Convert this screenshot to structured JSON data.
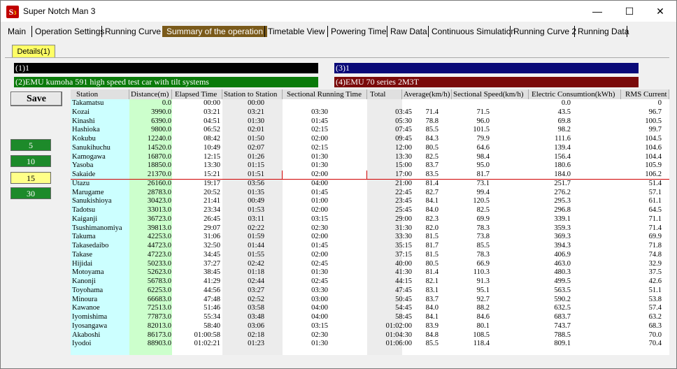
{
  "window": {
    "title": "Super Notch Man 3",
    "icon_letter": "S",
    "icon_sub": "3"
  },
  "controls": {
    "minimize": "—",
    "maximize": "☐",
    "close": "✕"
  },
  "tabs": [
    "Main",
    "Operation Settings",
    "Running Curve",
    "Summary of the operation",
    "Timetable View",
    "Powering Time",
    "Raw Data",
    "Continuous Simulation",
    "Running Curve 2",
    "Running Data"
  ],
  "active_tab": "Summary of the operation",
  "subtab": "Details(1)",
  "bars": {
    "b1": {
      "label": "(1)1",
      "color": "#000000"
    },
    "b2": {
      "label": "(2)EMU kumoha 591 high speed test car with tilt systems",
      "color": "#0a7a0a"
    },
    "b3": {
      "label": "(3)1",
      "color": "#0a0a78"
    },
    "b4": {
      "label": "(4)EMU 70 series  2M3T",
      "color": "#7a0a0a"
    }
  },
  "save_label": "Save",
  "speed_buttons": [
    "5",
    "10",
    "15",
    "30"
  ],
  "selected_speed": "15",
  "columns": [
    "Station",
    "Distance(m)",
    "Elapsed Time",
    "Station to Station",
    "Sectional Running Time",
    "Total",
    "Average(km/h)",
    "Sectional Speed(km/h)",
    "Electric Consumtion(kWh)",
    "RMS Current"
  ],
  "rows": [
    [
      "Takamatsu",
      "0.0",
      "00:00",
      "00:00",
      "",
      "",
      "",
      "",
      "0.0",
      "0"
    ],
    [
      "Kozai",
      "3990.0",
      "03:21",
      "03:21",
      "03:30",
      "03:45",
      "71.4",
      "71.5",
      "43.5",
      "96.7"
    ],
    [
      "Kinashi",
      "6390.0",
      "04:51",
      "01:30",
      "01:45",
      "05:30",
      "78.8",
      "96.0",
      "69.8",
      "100.5"
    ],
    [
      "Hashioka",
      "9800.0",
      "06:52",
      "02:01",
      "02:15",
      "07:45",
      "85.5",
      "101.5",
      "98.2",
      "99.7"
    ],
    [
      "Kokubu",
      "12240.0",
      "08:42",
      "01:50",
      "02:00",
      "09:45",
      "84.3",
      "79.9",
      "111.6",
      "104.5"
    ],
    [
      "Sanukihuchu",
      "14520.0",
      "10:49",
      "02:07",
      "02:15",
      "12:00",
      "80.5",
      "64.6",
      "139.4",
      "104.6"
    ],
    [
      "Kamogawa",
      "16870.0",
      "12:15",
      "01:26",
      "01:30",
      "13:30",
      "82.5",
      "98.4",
      "156.4",
      "104.4"
    ],
    [
      "Yasoba",
      "18850.0",
      "13:30",
      "01:15",
      "01:30",
      "15:00",
      "83.7",
      "95.0",
      "180.6",
      "105.9"
    ],
    [
      "Sakaide",
      "21370.0",
      "15:21",
      "01:51",
      "02:00",
      "17:00",
      "83.5",
      "81.7",
      "184.0",
      "106.2"
    ],
    [
      "Utazu",
      "26160.0",
      "19:17",
      "03:56",
      "04:00",
      "21:00",
      "81.4",
      "73.1",
      "251.7",
      "51.4"
    ],
    [
      "Marugame",
      "28783.0",
      "20:52",
      "01:35",
      "01:45",
      "22:45",
      "82.7",
      "99.4",
      "276.2",
      "57.1"
    ],
    [
      "Sanukishioya",
      "30423.0",
      "21:41",
      "00:49",
      "01:00",
      "23:45",
      "84.1",
      "120.5",
      "295.3",
      "61.1"
    ],
    [
      "Tadotsu",
      "33013.0",
      "23:34",
      "01:53",
      "02:00",
      "25:45",
      "84.0",
      "82.5",
      "296.8",
      "64.5"
    ],
    [
      "Kaiganji",
      "36723.0",
      "26:45",
      "03:11",
      "03:15",
      "29:00",
      "82.3",
      "69.9",
      "339.1",
      "71.1"
    ],
    [
      "Tsushimanomiya",
      "39813.0",
      "29:07",
      "02:22",
      "02:30",
      "31:30",
      "82.0",
      "78.3",
      "359.3",
      "71.4"
    ],
    [
      "Takuma",
      "42253.0",
      "31:06",
      "01:59",
      "02:00",
      "33:30",
      "81.5",
      "73.8",
      "369.3",
      "69.9"
    ],
    [
      "Takasedaibo",
      "44723.0",
      "32:50",
      "01:44",
      "01:45",
      "35:15",
      "81.7",
      "85.5",
      "394.3",
      "71.8"
    ],
    [
      "Takase",
      "47223.0",
      "34:45",
      "01:55",
      "02:00",
      "37:15",
      "81.5",
      "78.3",
      "406.9",
      "74.8"
    ],
    [
      "Hijidai",
      "50233.0",
      "37:27",
      "02:42",
      "02:45",
      "40:00",
      "80.5",
      "66.9",
      "463.0",
      "32.9"
    ],
    [
      "Motoyama",
      "52623.0",
      "38:45",
      "01:18",
      "01:30",
      "41:30",
      "81.4",
      "110.3",
      "480.3",
      "37.5"
    ],
    [
      "Kanonji",
      "56783.0",
      "41:29",
      "02:44",
      "02:45",
      "44:15",
      "82.1",
      "91.3",
      "499.5",
      "42.6"
    ],
    [
      "Toyohama",
      "62253.0",
      "44:56",
      "03:27",
      "03:30",
      "47:45",
      "83.1",
      "95.1",
      "563.5",
      "51.1"
    ],
    [
      "Minoura",
      "66683.0",
      "47:48",
      "02:52",
      "03:00",
      "50:45",
      "83.7",
      "92.7",
      "590.2",
      "53.8"
    ],
    [
      "Kawanoe",
      "72513.0",
      "51:46",
      "03:58",
      "04:00",
      "54:45",
      "84.0",
      "88.2",
      "632.5",
      "57.4"
    ],
    [
      "Iyomishima",
      "77873.0",
      "55:34",
      "03:48",
      "04:00",
      "58:45",
      "84.1",
      "84.6",
      "683.7",
      "63.2"
    ],
    [
      "Iyosangawa",
      "82013.0",
      "58:40",
      "03:06",
      "03:15",
      "01:02:00",
      "83.9",
      "80.1",
      "743.7",
      "68.3"
    ],
    [
      "Akaboshi",
      "86173.0",
      "01:00:58",
      "02:18",
      "02:30",
      "01:04:30",
      "84.8",
      "108.5",
      "788.5",
      "70.0"
    ],
    [
      "Iyodoi",
      "88903.0",
      "01:02:21",
      "01:23",
      "01:30",
      "01:06:00",
      "85.5",
      "118.4",
      "809.1",
      "70.4"
    ]
  ]
}
